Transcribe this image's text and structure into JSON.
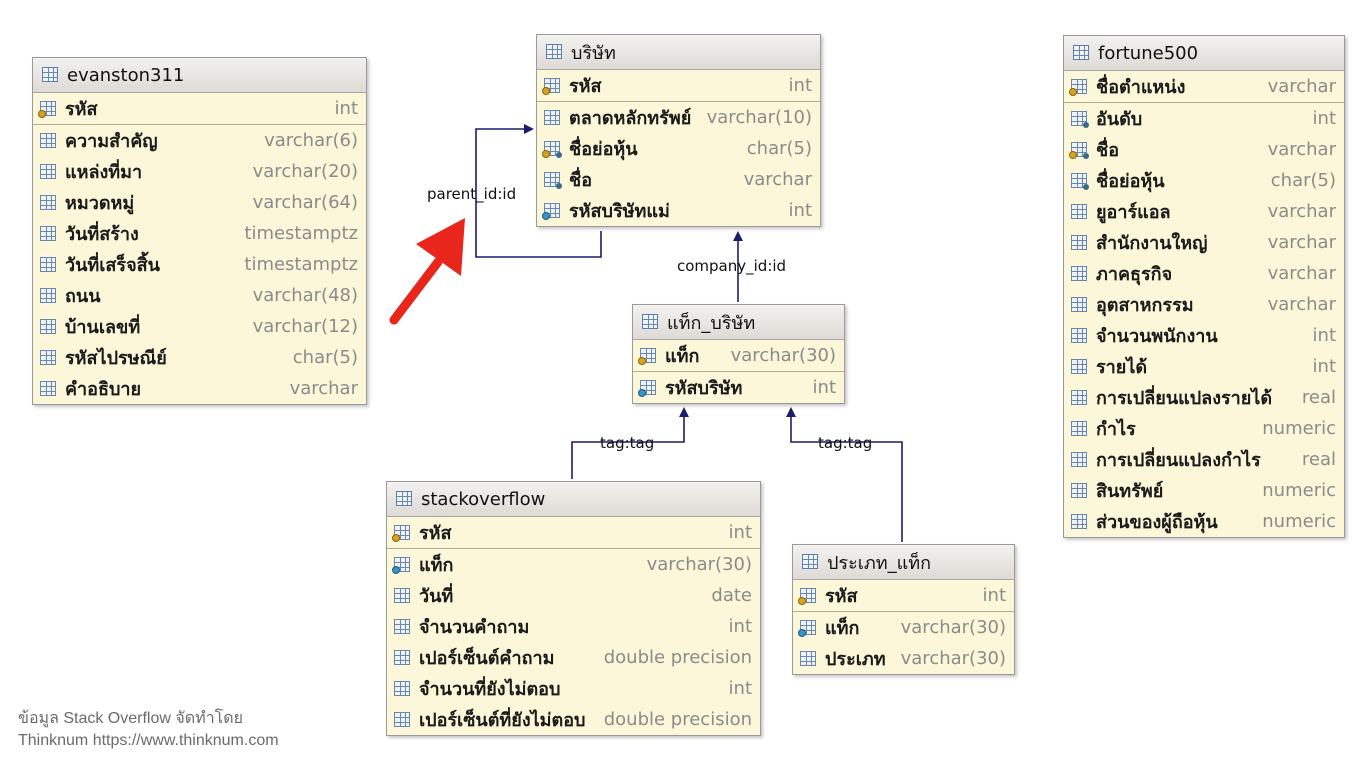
{
  "tables": {
    "evanston": {
      "name": "evanston311",
      "rows": [
        {
          "name": "รหัส",
          "type": "int",
          "icon": "primary-key-icon"
        },
        {
          "name": "ความสำคัญ",
          "type": "varchar(6)",
          "icon": "column-icon"
        },
        {
          "name": "แหล่งที่มา",
          "type": "varchar(20)",
          "icon": "column-icon"
        },
        {
          "name": "หมวดหมู่",
          "type": "varchar(64)",
          "icon": "column-icon"
        },
        {
          "name": "วันที่สร้าง",
          "type": "timestamptz",
          "icon": "column-icon"
        },
        {
          "name": "วันที่เสร็จสิ้น",
          "type": "timestamptz",
          "icon": "column-icon"
        },
        {
          "name": "ถนน",
          "type": "varchar(48)",
          "icon": "column-icon"
        },
        {
          "name": "บ้านเลขที่",
          "type": "varchar(12)",
          "icon": "column-icon"
        },
        {
          "name": "รหัสไปรษณีย์",
          "type": "char(5)",
          "icon": "column-icon"
        },
        {
          "name": "คำอธิบาย",
          "type": "varchar",
          "icon": "column-icon"
        }
      ]
    },
    "company": {
      "name": "บริษัท",
      "rows": [
        {
          "name": "รหัส",
          "type": "int",
          "icon": "primary-key-icon"
        },
        {
          "name": "ตลาดหลักทรัพย์",
          "type": "varchar(10)",
          "icon": "column-icon"
        },
        {
          "name": "ชื่อย่อหุ้น",
          "type": "char(5)",
          "icon": "unique-key-icon"
        },
        {
          "name": "ชื่อ",
          "type": "varchar",
          "icon": "indexed-column-icon"
        },
        {
          "name": "รหัสบริษัทแม่",
          "type": "int",
          "icon": "foreign-key-icon"
        }
      ]
    },
    "tag_company": {
      "name": "แท็ก_บริษัท",
      "rows": [
        {
          "name": "แท็ก",
          "type": "varchar(30)",
          "icon": "primary-key-icon"
        },
        {
          "name": "รหัสบริษัท",
          "type": "int",
          "icon": "foreign-key-icon"
        }
      ]
    },
    "stackoverflow": {
      "name": "stackoverflow",
      "rows": [
        {
          "name": "รหัส",
          "type": "int",
          "icon": "primary-key-icon"
        },
        {
          "name": "แท็ก",
          "type": "varchar(30)",
          "icon": "foreign-key-icon"
        },
        {
          "name": "วันที่",
          "type": "date",
          "icon": "column-icon"
        },
        {
          "name": "จำนวนคำถาม",
          "type": "int",
          "icon": "column-icon"
        },
        {
          "name": "เปอร์เซ็นต์คำถาม",
          "type": "double precision",
          "icon": "column-icon"
        },
        {
          "name": "จำนวนที่ยังไม่ตอบ",
          "type": "int",
          "icon": "column-icon"
        },
        {
          "name": "เปอร์เซ็นต์ที่ยังไม่ตอบ",
          "type": "double precision",
          "icon": "column-icon"
        }
      ]
    },
    "tag_type": {
      "name": "ประเภท_แท็ก",
      "rows": [
        {
          "name": "รหัส",
          "type": "int",
          "icon": "primary-key-icon"
        },
        {
          "name": "แท็ก",
          "type": "varchar(30)",
          "icon": "foreign-key-icon"
        },
        {
          "name": "ประเภท",
          "type": "varchar(30)",
          "icon": "column-icon"
        }
      ]
    },
    "fortune": {
      "name": "fortune500",
      "rows": [
        {
          "name": "ชื่อตำแหน่ง",
          "type": "varchar",
          "icon": "primary-key-icon"
        },
        {
          "name": "อันดับ",
          "type": "int",
          "icon": "indexed-column-icon"
        },
        {
          "name": "ชื่อ",
          "type": "varchar",
          "icon": "unique-key-icon"
        },
        {
          "name": "ชื่อย่อหุ้น",
          "type": "char(5)",
          "icon": "indexed-column-icon"
        },
        {
          "name": "ยูอาร์แอล",
          "type": "varchar",
          "icon": "column-icon"
        },
        {
          "name": "สำนักงานใหญ่",
          "type": "varchar",
          "icon": "column-icon"
        },
        {
          "name": "ภาคธุรกิจ",
          "type": "varchar",
          "icon": "column-icon"
        },
        {
          "name": "อุตสาหกรรม",
          "type": "varchar",
          "icon": "column-icon"
        },
        {
          "name": "จำนวนพนักงาน",
          "type": "int",
          "icon": "column-icon"
        },
        {
          "name": "รายได้",
          "type": "int",
          "icon": "column-icon"
        },
        {
          "name": "การเปลี่ยนแปลงรายได้",
          "type": "real",
          "icon": "column-icon"
        },
        {
          "name": "กำไร",
          "type": "numeric",
          "icon": "column-icon"
        },
        {
          "name": "การเปลี่ยนแปลงกำไร",
          "type": "real",
          "icon": "column-icon"
        },
        {
          "name": "สินทรัพย์",
          "type": "numeric",
          "icon": "column-icon"
        },
        {
          "name": "ส่วนของผู้ถือหุ้น",
          "type": "numeric",
          "icon": "column-icon"
        }
      ]
    }
  },
  "relations": {
    "parent": "parent_id:id",
    "company": "company_id:id",
    "tag_left": "tag:tag",
    "tag_right": "tag:tag"
  },
  "colors": {
    "relation_line": "#1c1c6e",
    "annotation_arrow": "#e8261c",
    "table_fill": "#fbf7d8"
  },
  "credit": {
    "line1": "ข้อมูล Stack Overflow จัดทำโดย",
    "line2": "Thinknum https://www.thinknum.com"
  }
}
